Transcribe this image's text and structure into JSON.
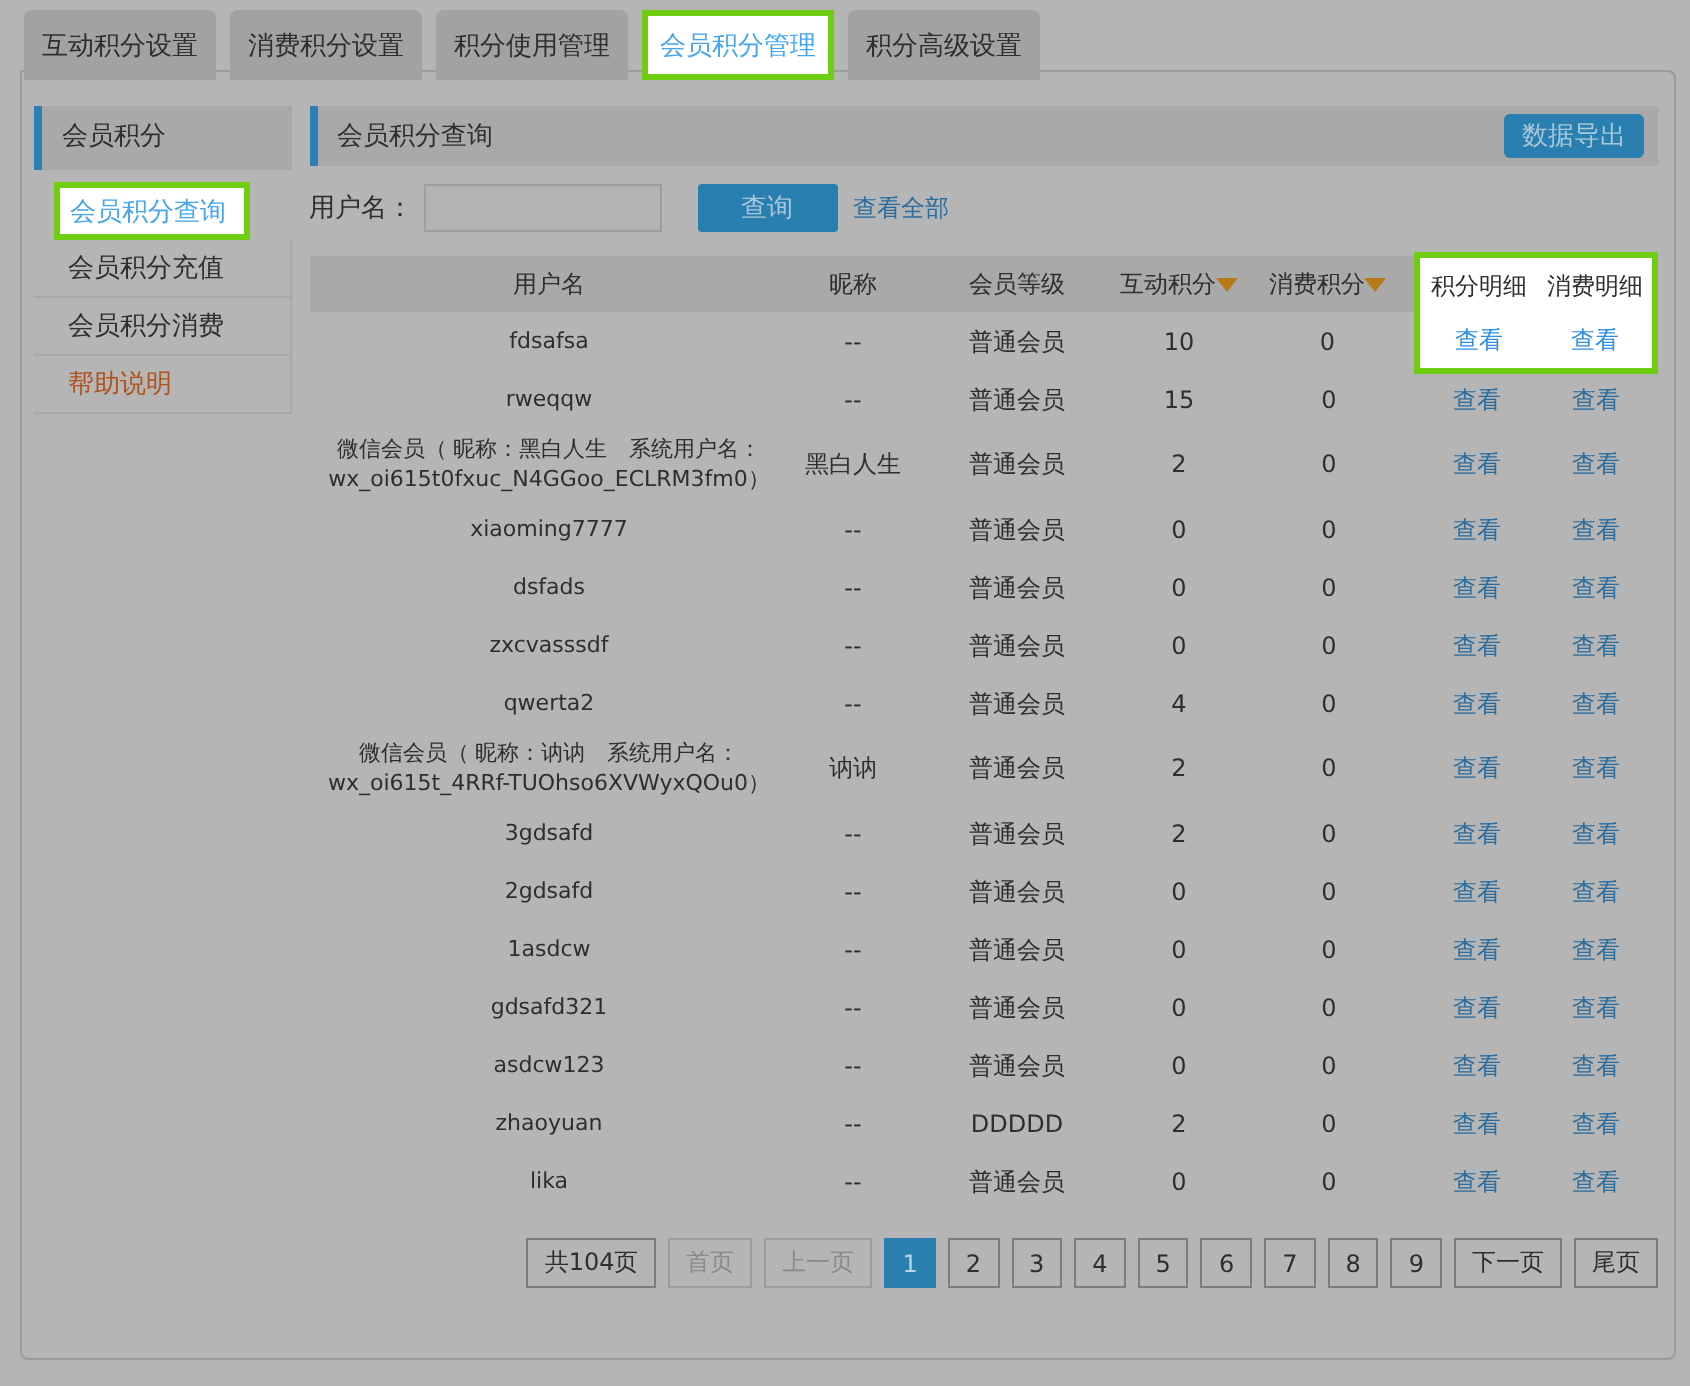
{
  "tabs": [
    {
      "label": "互动积分设置",
      "selected": false,
      "highlighted": false
    },
    {
      "label": "消费积分设置",
      "selected": false,
      "highlighted": false
    },
    {
      "label": "积分使用管理",
      "selected": false,
      "highlighted": false
    },
    {
      "label": "会员积分管理",
      "selected": true,
      "highlighted": true
    },
    {
      "label": "积分高级设置",
      "selected": false,
      "highlighted": false
    }
  ],
  "sidebar": {
    "title": "会员积分",
    "items": [
      {
        "label": "会员积分查询",
        "selected": true,
        "highlighted": true,
        "kind": "nav"
      },
      {
        "label": "会员积分充值",
        "selected": false,
        "highlighted": false,
        "kind": "nav"
      },
      {
        "label": "会员积分消费",
        "selected": false,
        "highlighted": false,
        "kind": "nav"
      },
      {
        "label": "帮助说明",
        "selected": false,
        "highlighted": false,
        "kind": "help"
      }
    ]
  },
  "main": {
    "title": "会员积分查询",
    "export_button": "数据导出",
    "search": {
      "label": "用户名：",
      "button": "查询",
      "show_all": "查看全部"
    },
    "table": {
      "columns": [
        {
          "label": "用户名",
          "sortable": false,
          "highlighted": false
        },
        {
          "label": "昵称",
          "sortable": false,
          "highlighted": false
        },
        {
          "label": "会员等级",
          "sortable": false,
          "highlighted": false
        },
        {
          "label": "互动积分",
          "sortable": true,
          "highlighted": false
        },
        {
          "label": "消费积分",
          "sortable": true,
          "highlighted": false
        },
        {
          "label": "积分明细",
          "sortable": false,
          "highlighted": true
        },
        {
          "label": "消费明细",
          "sortable": false,
          "highlighted": true
        }
      ],
      "rows": [
        {
          "highlighted": true,
          "cells": [
            "fdsafsa",
            "--",
            "普通会员",
            "10",
            "0",
            "查看",
            "查看"
          ]
        },
        {
          "highlighted": false,
          "cells": [
            "rweqqw",
            "--",
            "普通会员",
            "15",
            "0",
            "查看",
            "查看"
          ]
        },
        {
          "highlighted": false,
          "cells": [
            "微信会员（ 昵称：黑白人生　系统用户名：wx_oi615t0fxuc_N4GGoo_ECLRM3fm0）",
            "黑白人生",
            "普通会员",
            "2",
            "0",
            "查看",
            "查看"
          ]
        },
        {
          "highlighted": false,
          "cells": [
            "xiaoming7777",
            "--",
            "普通会员",
            "0",
            "0",
            "查看",
            "查看"
          ]
        },
        {
          "highlighted": false,
          "cells": [
            "dsfads",
            "--",
            "普通会员",
            "0",
            "0",
            "查看",
            "查看"
          ]
        },
        {
          "highlighted": false,
          "cells": [
            "zxcvasssdf",
            "--",
            "普通会员",
            "0",
            "0",
            "查看",
            "查看"
          ]
        },
        {
          "highlighted": false,
          "cells": [
            "qwerta2",
            "--",
            "普通会员",
            "4",
            "0",
            "查看",
            "查看"
          ]
        },
        {
          "highlighted": false,
          "cells": [
            "微信会员（ 昵称：讷讷　系统用户名：wx_oi615t_4RRf-TUOhso6XVWyxQOu0）",
            "讷讷",
            "普通会员",
            "2",
            "0",
            "查看",
            "查看"
          ]
        },
        {
          "highlighted": false,
          "cells": [
            "3gdsafd",
            "--",
            "普通会员",
            "2",
            "0",
            "查看",
            "查看"
          ]
        },
        {
          "highlighted": false,
          "cells": [
            "2gdsafd",
            "--",
            "普通会员",
            "0",
            "0",
            "查看",
            "查看"
          ]
        },
        {
          "highlighted": false,
          "cells": [
            "1asdcw",
            "--",
            "普通会员",
            "0",
            "0",
            "查看",
            "查看"
          ]
        },
        {
          "highlighted": false,
          "cells": [
            "gdsafd321",
            "--",
            "普通会员",
            "0",
            "0",
            "查看",
            "查看"
          ]
        },
        {
          "highlighted": false,
          "cells": [
            "asdcw123",
            "--",
            "普通会员",
            "0",
            "0",
            "查看",
            "查看"
          ]
        },
        {
          "highlighted": false,
          "cells": [
            "zhaoyuan",
            "--",
            "DDDDD",
            "2",
            "0",
            "查看",
            "查看"
          ]
        },
        {
          "highlighted": false,
          "cells": [
            "lika",
            "--",
            "普通会员",
            "0",
            "0",
            "查看",
            "查看"
          ]
        }
      ]
    },
    "pagination": [
      {
        "label": "共104页",
        "disabled": false,
        "selected": false
      },
      {
        "label": "首页",
        "disabled": true,
        "selected": false
      },
      {
        "label": "上一页",
        "disabled": true,
        "selected": false
      },
      {
        "label": "1",
        "disabled": false,
        "selected": true
      },
      {
        "label": "2",
        "disabled": false,
        "selected": false
      },
      {
        "label": "3",
        "disabled": false,
        "selected": false
      },
      {
        "label": "4",
        "disabled": false,
        "selected": false
      },
      {
        "label": "5",
        "disabled": false,
        "selected": false
      },
      {
        "label": "6",
        "disabled": false,
        "selected": false
      },
      {
        "label": "7",
        "disabled": false,
        "selected": false
      },
      {
        "label": "8",
        "disabled": false,
        "selected": false
      },
      {
        "label": "9",
        "disabled": false,
        "selected": false
      },
      {
        "label": "下一页",
        "disabled": false,
        "selected": false
      },
      {
        "label": "尾页",
        "disabled": false,
        "selected": false
      }
    ]
  }
}
